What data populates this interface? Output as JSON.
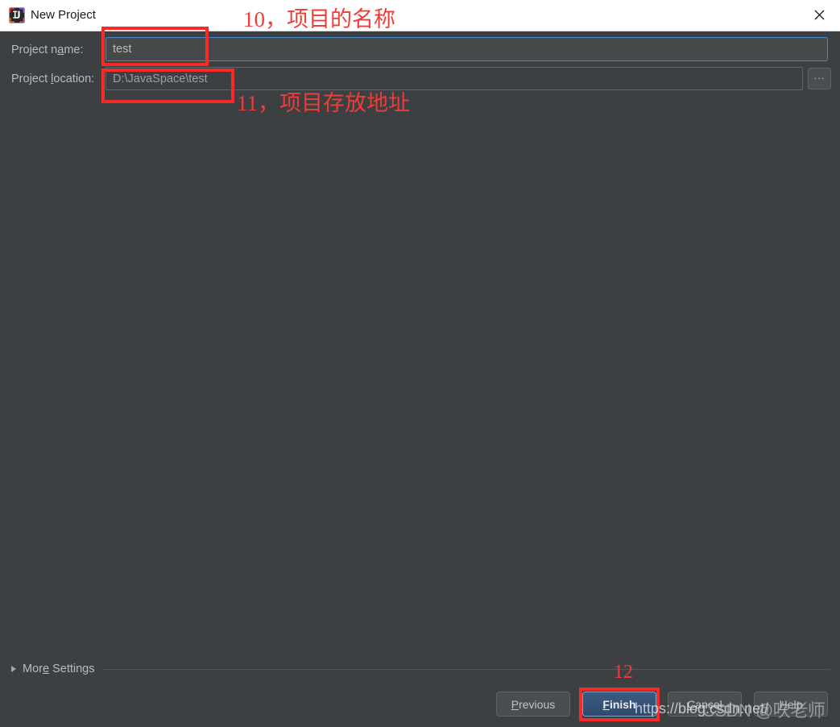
{
  "window": {
    "title": "New Project",
    "icon": "intellij-idea-icon",
    "close_icon": "close-icon"
  },
  "form": {
    "project_name": {
      "label_before": "Project n",
      "label_mnemonic": "a",
      "label_after": "me:",
      "value": "test",
      "placeholder": ""
    },
    "project_location": {
      "label_before": "Project ",
      "label_mnemonic": "l",
      "label_after": "ocation:",
      "value": "D:\\JavaSpace\\test",
      "placeholder": ""
    },
    "browse_button": {
      "label": "...",
      "icon": "ellipsis-icon"
    }
  },
  "more_settings": {
    "label_before": "Mor",
    "label_mnemonic": "e",
    "label_after": " Settings",
    "arrow_icon": "chevron-right-icon",
    "expanded": false
  },
  "buttons": {
    "previous": {
      "before": "",
      "mnemonic": "P",
      "after": "revious"
    },
    "finish": {
      "before": "",
      "mnemonic": "F",
      "after": "inish"
    },
    "cancel": {
      "before": "",
      "mnemonic": "C",
      "after": "ancel"
    },
    "help": {
      "before": "",
      "mnemonic": "H",
      "after": "elp"
    }
  },
  "annotations": {
    "name_note": "10，项目的名称",
    "location_note": "11，项目存放地址",
    "finish_note": "12",
    "color": "#f03c37"
  },
  "watermarks": {
    "url": "https://blog.csdn.net/",
    "author": "CSDN @吹老师"
  },
  "colors": {
    "dialog_background": "#3c4043",
    "titlebar_background": "#ffffff",
    "focus_border": "#4a88c7",
    "text": "#bbbbbb",
    "annotation_red": "#f82a28",
    "finish_button": "#3c5a80"
  }
}
